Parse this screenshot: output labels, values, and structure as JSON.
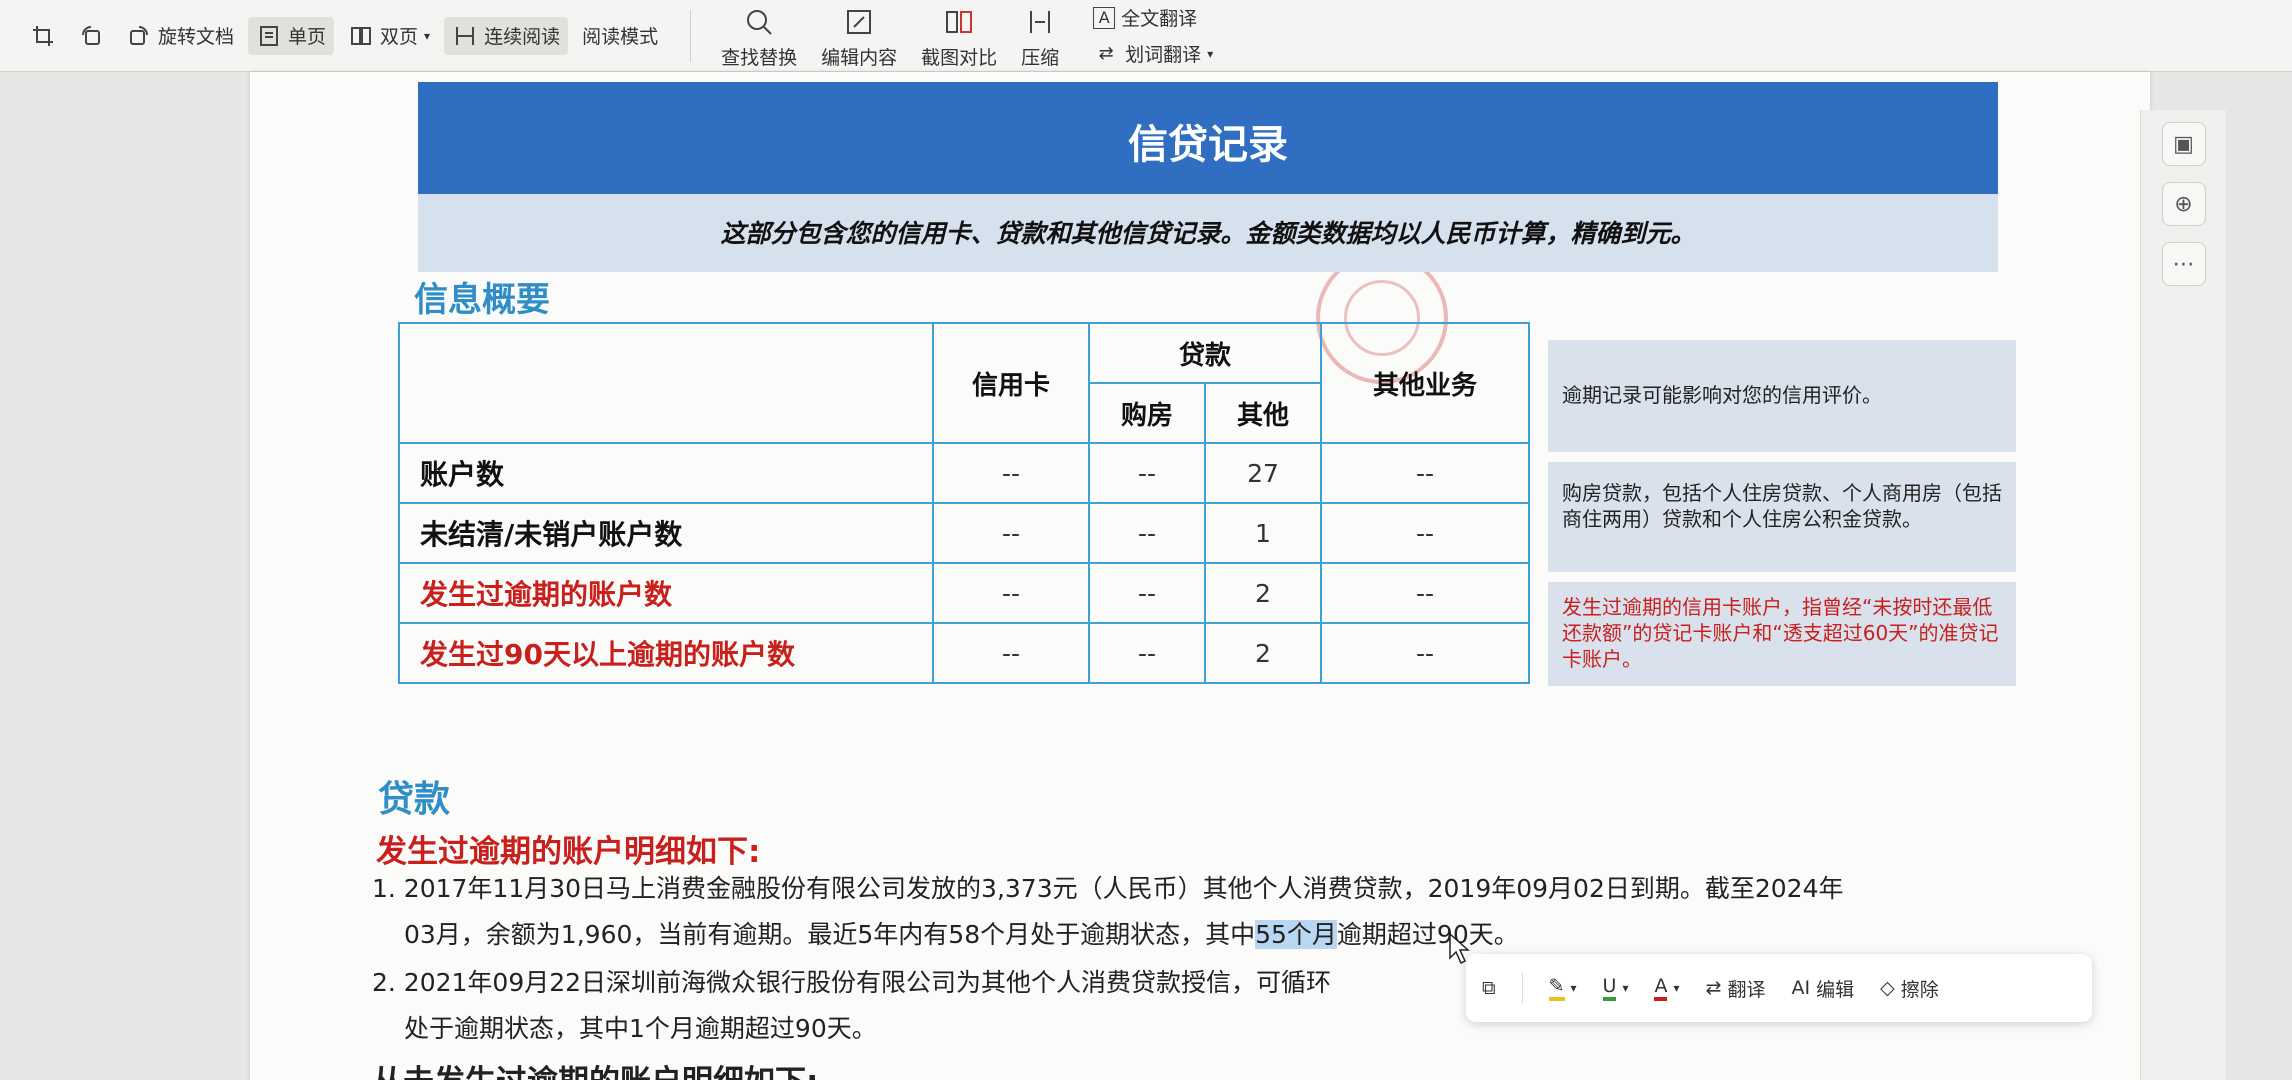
{
  "toolbar": {
    "rotate": "旋转文档",
    "single_page": "单页",
    "double_page": "双页",
    "continuous": "连续阅读",
    "reading_mode": "阅读模式",
    "find_replace": "查找替换",
    "edit_content": "编辑内容",
    "screenshot_compare": "截图对比",
    "compress": "压缩",
    "full_translate": "全文翻译",
    "word_translate": "划词翻译"
  },
  "banner": {
    "title": "信贷记录",
    "subtitle": "这部分包含您的信用卡、贷款和其他信贷记录。金额类数据均以人民币计算，精确到元。"
  },
  "summary": {
    "heading": "信息概要",
    "headers": {
      "credit_card": "信用卡",
      "loan": "贷款",
      "housing": "购房",
      "other": "其他",
      "other_business": "其他业务"
    },
    "rows": [
      {
        "label": "账户数",
        "credit_card": "--",
        "housing": "--",
        "other": "27",
        "other_business": "--"
      },
      {
        "label": "未结清/未销户账户数",
        "credit_card": "--",
        "housing": "--",
        "other": "1",
        "other_business": "--"
      },
      {
        "label": "发生过逾期的账户数",
        "credit_card": "--",
        "housing": "--",
        "other": "2",
        "other_business": "--"
      },
      {
        "label": "发生过90天以上逾期的账户数",
        "credit_card": "--",
        "housing": "--",
        "other": "2",
        "other_business": "--"
      }
    ]
  },
  "notes": [
    "逾期记录可能影响对您的信用评价。",
    "购房贷款，包括个人住房贷款、个人商用房（包括商住两用）贷款和个人住房公积金贷款。",
    "发生过逾期的信用卡账户，指曾经“未按时还最低还款额”的贷记卡账户和“透支超过60天”的准贷记卡账户。"
  ],
  "loans": {
    "heading": "贷款",
    "overdue_title": "发生过逾期的账户明细如下:",
    "item1_line1": "1. 2017年11月30日马上消费金融股份有限公司发放的3,373元（人民币）其他个人消费贷款，2019年09月02日到期。截至2024年",
    "item1_line2_a": "03月，余额为1,960，当前有逾期。最近5年内有58个月处于逾期状态，其中",
    "item1_line2_hl": "55个月",
    "item1_line2_b": "逾期超过90天。",
    "item2_line1": "2. 2021年09月22日深圳前海微众银行股份有限公司为其他个人消费贷款授信，可循环",
    "item2_line2": "处于逾期状态，其中1个月逾期超过90天。",
    "next_heading": "从未发生过逾期的账户明细如下:"
  },
  "float_bar": {
    "translate": "翻译",
    "ai_edit": "编辑",
    "erase": "擦除"
  },
  "colors": {
    "banner": "#2f6ec0",
    "heading_blue": "#2f8ec8",
    "red": "#c8201c",
    "table_border": "#3fa0d8"
  }
}
